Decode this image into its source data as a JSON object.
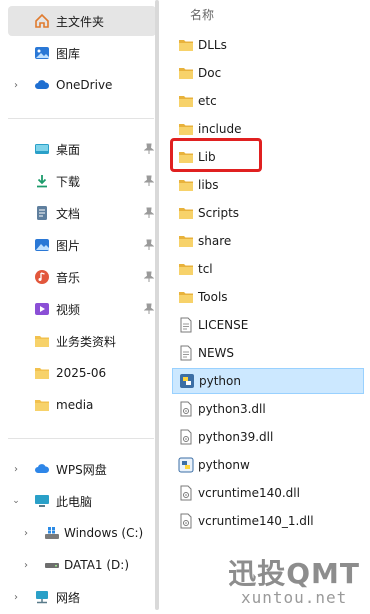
{
  "nav": {
    "home": "主文件夹",
    "gallery": "图库",
    "onedrive": "OneDrive",
    "quick_access": [
      "桌面",
      "下载",
      "文档",
      "图片",
      "音乐",
      "视频",
      "业务类资料",
      "2025-06",
      "media"
    ],
    "wps": "WPS网盘",
    "this_pc": "此电脑",
    "drive_c": "Windows (C:)",
    "drive_d": "DATA1 (D:)",
    "network": "网络"
  },
  "list": {
    "column_header": "名称",
    "items": [
      "DLLs",
      "Doc",
      "etc",
      "include",
      "Lib",
      "libs",
      "Scripts",
      "share",
      "tcl",
      "Tools",
      "LICENSE",
      "NEWS",
      "python",
      "python3.dll",
      "python39.dll",
      "pythonw",
      "vcruntime140.dll",
      "vcruntime140_1.dll"
    ],
    "selected": "python",
    "highlighted": "Lib"
  },
  "watermark": {
    "line1": "迅投QMT",
    "line2": "xuntou.net"
  },
  "colors": {
    "folder": "#f2c14e",
    "selection": "#cce8ff",
    "highlight_box": "#e02020"
  }
}
